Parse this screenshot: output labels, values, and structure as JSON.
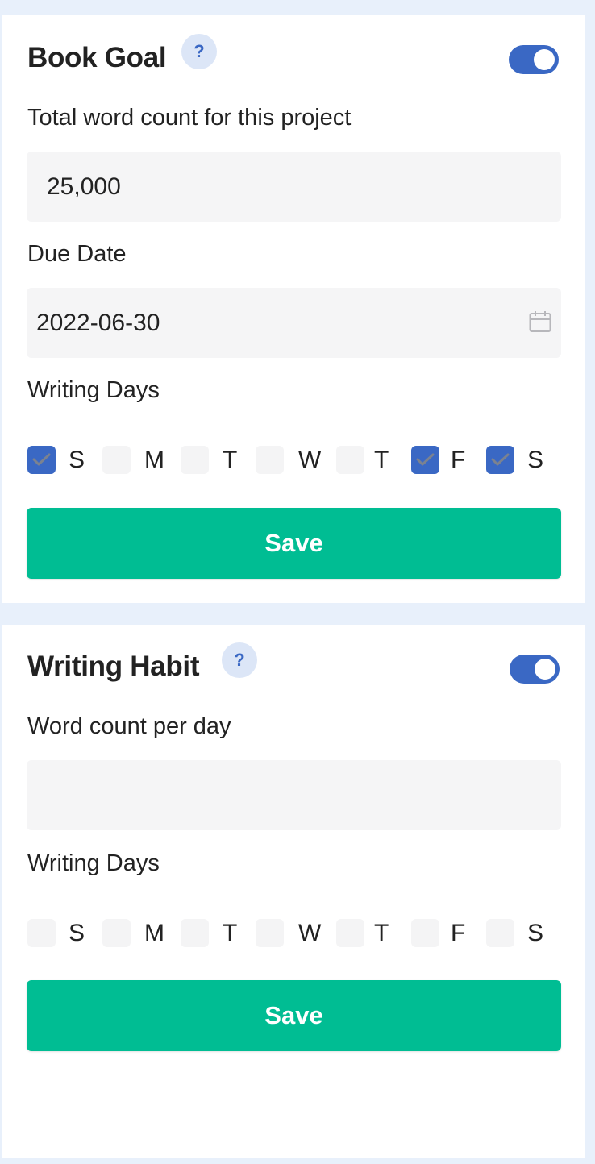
{
  "book_goal": {
    "title": "Book Goal",
    "help_label": "?",
    "enabled": true,
    "word_count_label": "Total word count for this project",
    "word_count_value": "25,000",
    "due_date_label": "Due Date",
    "due_date_value": "2022-06-30",
    "writing_days_label": "Writing Days",
    "days": [
      {
        "label": "S",
        "checked": true
      },
      {
        "label": "M",
        "checked": false
      },
      {
        "label": "T",
        "checked": false
      },
      {
        "label": "W",
        "checked": false
      },
      {
        "label": "T",
        "checked": false
      },
      {
        "label": "F",
        "checked": true
      },
      {
        "label": "S",
        "checked": true
      }
    ],
    "save_label": "Save"
  },
  "writing_habit": {
    "title": "Writing Habit",
    "help_label": "?",
    "enabled": true,
    "word_count_label": "Word count per day",
    "word_count_value": "",
    "writing_days_label": "Writing Days",
    "days": [
      {
        "label": "S",
        "checked": false
      },
      {
        "label": "M",
        "checked": false
      },
      {
        "label": "T",
        "checked": false
      },
      {
        "label": "W",
        "checked": false
      },
      {
        "label": "T",
        "checked": false
      },
      {
        "label": "F",
        "checked": false
      },
      {
        "label": "S",
        "checked": false
      }
    ],
    "save_label": "Save"
  },
  "colors": {
    "accent": "#3a68c4",
    "save_button": "#00bd93",
    "page_background": "#e8f0fb",
    "input_background": "#f5f5f6"
  },
  "icons": {
    "help": "question-mark-icon",
    "due_date": "calendar-icon",
    "checked_day": "checkmark-icon"
  }
}
